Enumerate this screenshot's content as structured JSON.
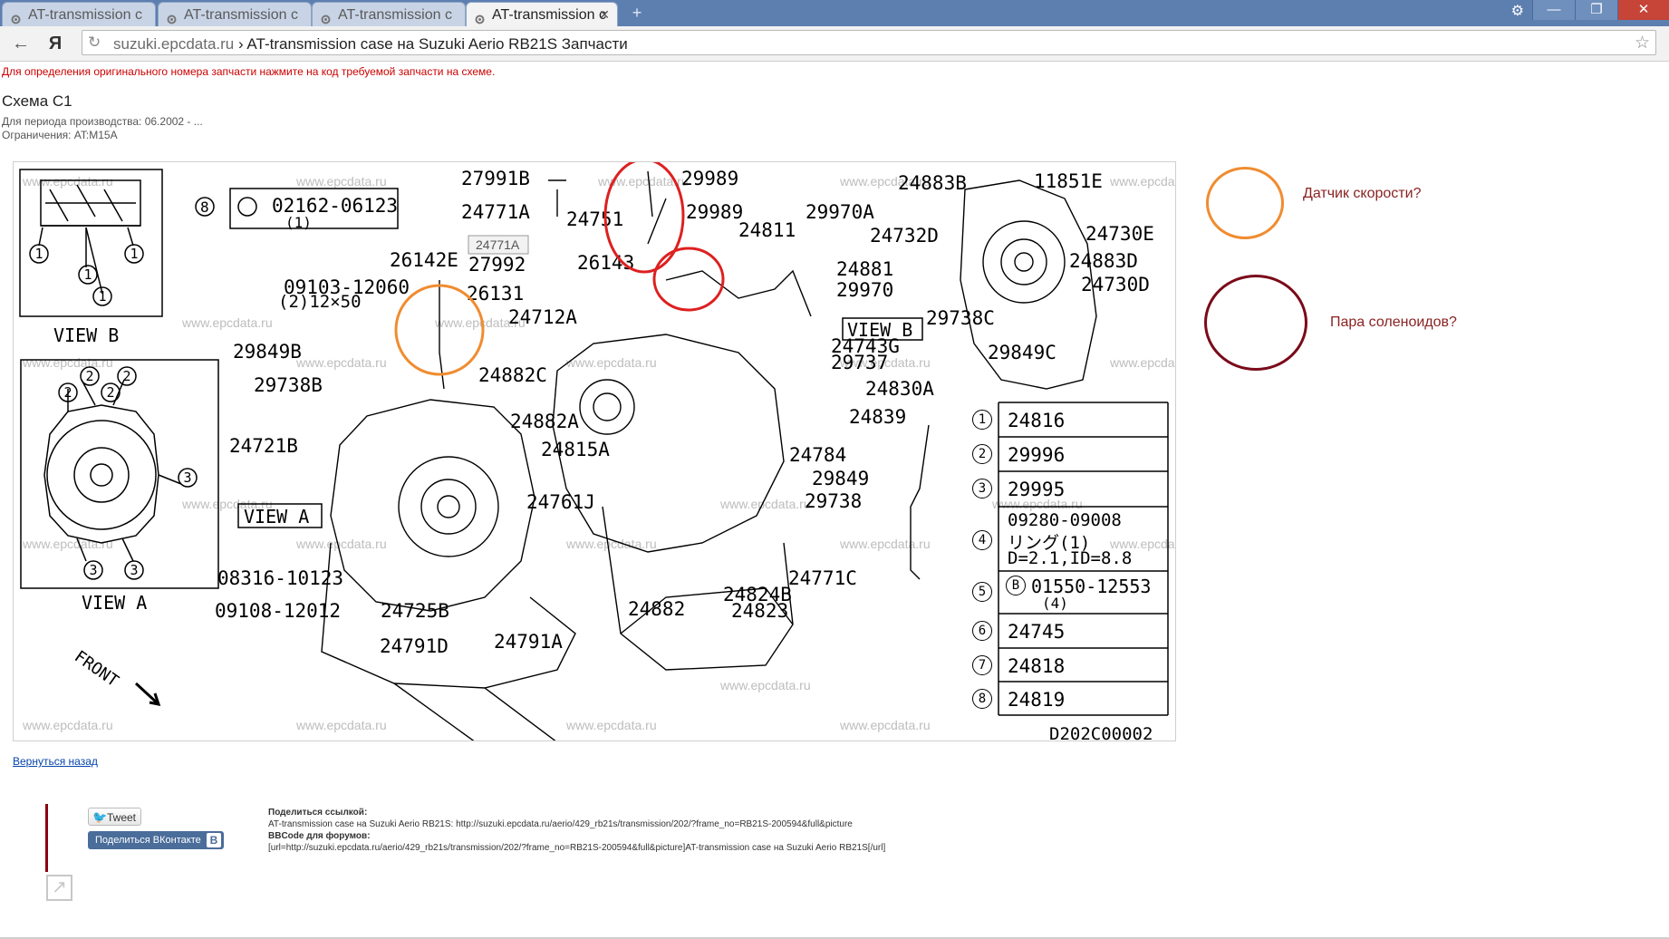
{
  "browser": {
    "tabs": [
      {
        "title": "AT-transmission c",
        "active": false
      },
      {
        "title": "AT-transmission c",
        "active": false
      },
      {
        "title": "AT-transmission c",
        "active": false
      },
      {
        "title": "AT-transmission c",
        "active": true
      }
    ],
    "back_icon": "back-arrow-icon",
    "yandex_label": "Я",
    "address": {
      "host": "suzuki.epcdata.ru",
      "separator": " › ",
      "title": "AT-transmission case на Suzuki Aerio RB21S Запчасти"
    }
  },
  "page": {
    "hint": "Для определения оригинального номера запчасти нажмите на код требуемой запчасти на схеме.",
    "scheme_title": "Схема C1",
    "period": "Для периода производства: 06.2002 - ...",
    "restrictions": "Ограничения: AT:M15A",
    "back_link": "Вернуться назад"
  },
  "diagram": {
    "diagram_code": "D202C00002",
    "watermark": "www.epcdata.ru",
    "tooltip": "24771A",
    "view_labels": {
      "view_b": "VIEW B",
      "view_a": "VIEW A",
      "view_b_box": "VIEW B",
      "view_a_box": "VIEW A",
      "front": "FRONT"
    },
    "part_labels": [
      "27991B",
      "29989",
      "29989",
      "24771A",
      "24751",
      "24811",
      "29970A",
      "24883B",
      "11851E",
      "24771A",
      "24732D",
      "24730E",
      "27992",
      "26143",
      "26142E",
      "24881",
      "24883D",
      "24730D",
      "09103-12060",
      "26131",
      "29970",
      "24712A",
      "29738C",
      "29849B",
      "24743G",
      "29849C",
      "29737",
      "29738B",
      "24882C",
      "24830A",
      "24882A",
      "24839",
      "24721B",
      "24815A",
      "24784",
      "29849",
      "24761J",
      "29738",
      "08316-10123",
      "24771C",
      "24824B",
      "24725B",
      "09108-12012",
      "24882",
      "24823",
      "24791D",
      "24791A",
      "02162-06123",
      "(1)",
      "(2)12×50"
    ],
    "legend": [
      {
        "num": "1",
        "part": "24816"
      },
      {
        "num": "2",
        "part": "29996"
      },
      {
        "num": "3",
        "part": "29995"
      },
      {
        "num": "4",
        "part": "09280-09008",
        "line2": "リング(1)",
        "line3": "D=2.1,ID=8.8"
      },
      {
        "num": "5",
        "part": "01550-12553",
        "prefix": "B",
        "line2": "(4)"
      },
      {
        "num": "6",
        "part": "24745"
      },
      {
        "num": "7",
        "part": "24818"
      },
      {
        "num": "8",
        "part": "24819"
      }
    ]
  },
  "annotations": [
    {
      "text": "Датчик скорости?",
      "color": "#f08c30"
    },
    {
      "text": "Пара соленоидов?",
      "color": "#7a0a1a"
    }
  ],
  "highlight_colors": {
    "red": "#dd2020",
    "orange": "#f08c30",
    "dark_red": "#7a0a1a"
  },
  "share": {
    "tweet_label": "Tweet",
    "vk_label": "Поделиться ВКонтакте",
    "vk_badge": "B",
    "link_heading": "Поделиться ссылкой:",
    "link_text": "AT-transmission case на Suzuki Aerio RB21S: http://suzuki.epcdata.ru/aerio/429_rb21s/transmission/202/?frame_no=RB21S-200594&full&picture",
    "bbcode_heading": "BBCode для форумов:",
    "bbcode_text": "[url=http://suzuki.epcdata.ru/aerio/429_rb21s/transmission/202/?frame_no=RB21S-200594&full&picture]AT-transmission case на Suzuki Aerio RB21S[/url]"
  }
}
